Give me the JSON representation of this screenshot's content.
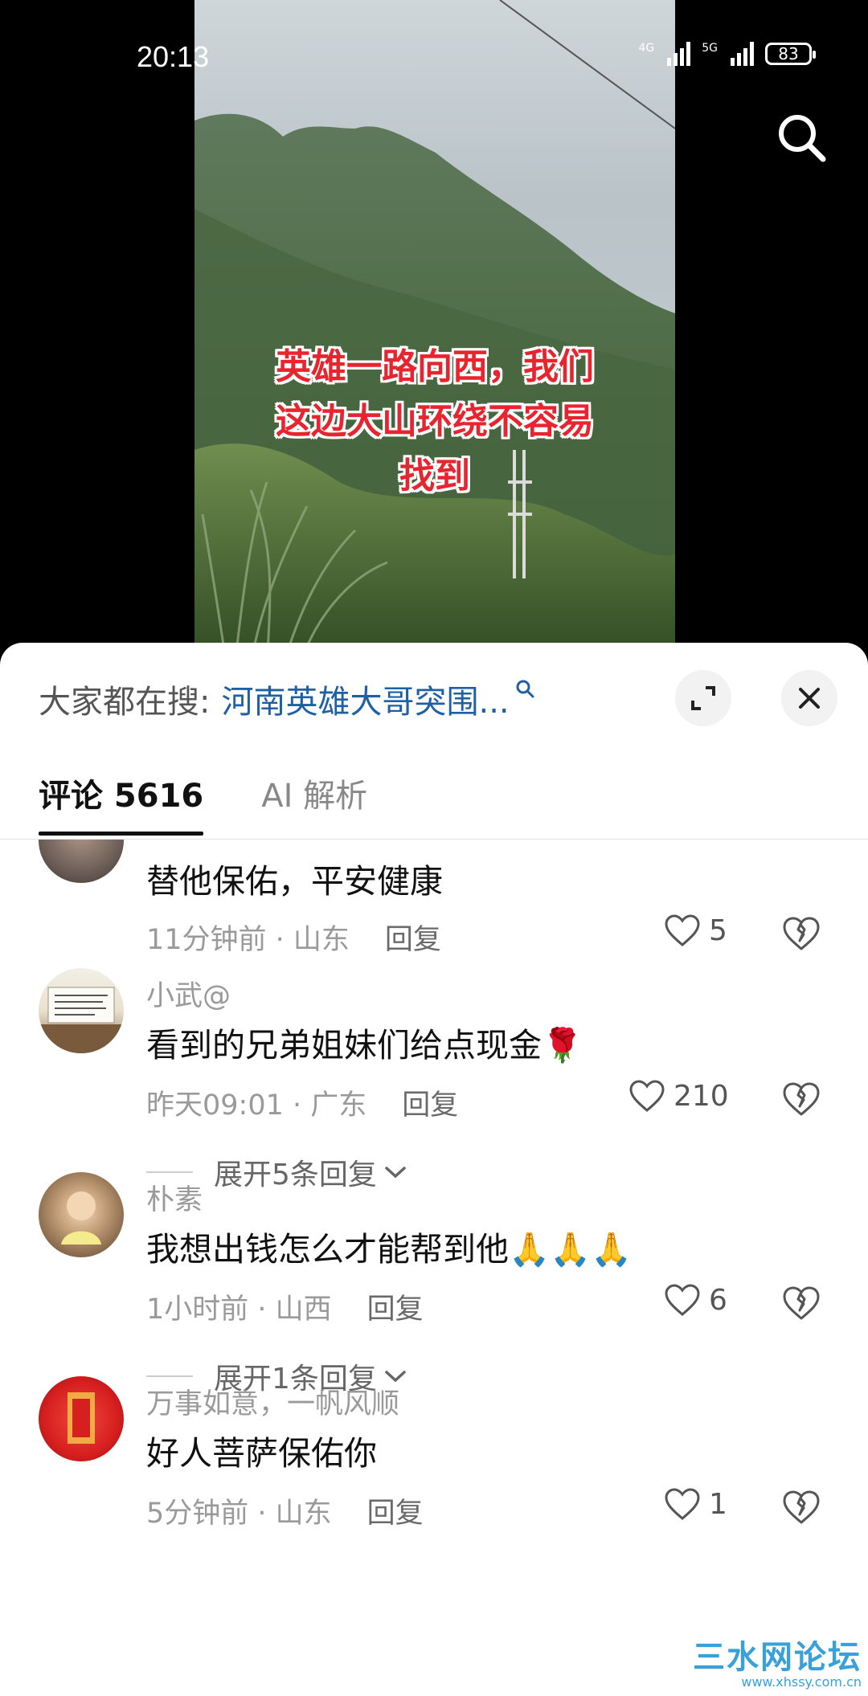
{
  "status_bar": {
    "time": "20:13",
    "network_1": "4G",
    "network_2": "5G",
    "battery": "83"
  },
  "video": {
    "caption_lines": [
      "英雄一路向西，我们",
      "这边大山环绕不容易",
      "找到"
    ]
  },
  "sheet": {
    "search_label": "大家都在搜:",
    "search_query": "河南英雄大哥突围...",
    "tabs": [
      {
        "label": "评论 5616",
        "active": true
      },
      {
        "label": "AI 解析",
        "active": false
      }
    ]
  },
  "comments": [
    {
      "name": "",
      "text": "替他保佑，平安健康",
      "time_loc": "11分钟前 · 山东",
      "reply": "回复",
      "likes": "5"
    },
    {
      "name": "小武@",
      "text": "看到的兄弟姐妹们给点现金🌹",
      "time_loc": "昨天09:01 · 广东",
      "reply": "回复",
      "likes": "210",
      "expand": "展开5条回复"
    },
    {
      "name": "朴素",
      "text": "我想出钱怎么才能帮到他🙏🙏🙏",
      "time_loc": "1小时前 · 山西",
      "reply": "回复",
      "likes": "6",
      "expand": "展开1条回复"
    },
    {
      "name": "万事如意，一帆风顺",
      "text": "好人菩萨保佑你",
      "time_loc": "5分钟前 · 山东",
      "reply": "回复",
      "likes": "1"
    }
  ],
  "watermark": {
    "title": "三水网论坛",
    "url": "www.xhssy.com.cn"
  },
  "colors": {
    "caption": "#e8242f",
    "search_query": "#1f5fa3",
    "watermark": "#3aa0d8"
  }
}
